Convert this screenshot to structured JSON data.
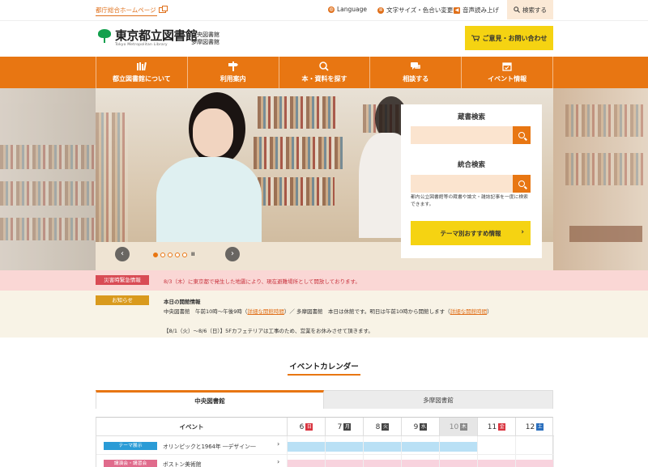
{
  "utility": {
    "portal_link": "都庁総合ホームページ",
    "language": "Language",
    "text_size": "文字サイズ・色合い変更",
    "voice": "音声読み上げ",
    "search": "検索する"
  },
  "header": {
    "logo_title": "東京都立図書館",
    "logo_sub": "Tokyo Metropolitan Library",
    "branch1": "中央図書館",
    "branch2": "多摩図書館",
    "contact": "ご意見・お問い合わせ"
  },
  "nav": {
    "items": [
      {
        "label": "都立図書館について",
        "icon": "books-icon"
      },
      {
        "label": "利用案内",
        "icon": "signpost-icon"
      },
      {
        "label": "本・資料を探す",
        "icon": "book-search-icon"
      },
      {
        "label": "相談する",
        "icon": "chat-icon"
      },
      {
        "label": "イベント情報",
        "icon": "calendar-icon"
      }
    ]
  },
  "hero": {
    "prev": "‹",
    "next": "›",
    "slide_count": 5,
    "active_slide": 1,
    "pause": "II"
  },
  "search_panel": {
    "catalog_heading": "蔵書検索",
    "unified_heading": "統合検索",
    "note": "都内公立図書館等の蔵書や論文・雑誌記事を一度に検索できます。",
    "theme_button": "テーマ別おすすめ情報"
  },
  "emergency": {
    "label": "災害時緊急情報",
    "text": "8/3（木）に東京都で発生した地震により、現在避難場所として開放しております。"
  },
  "news": {
    "label": "お知らせ",
    "heading": "本日の開館情報",
    "line1_a": "中央図書館　午前10時〜午後9時（",
    "line1_link1": "詳細な開館時間",
    "line1_b": "）／ 多摩図書館　本日は休館です。明日は午前10時から開館します（",
    "line1_link2": "詳細な開館時間",
    "line1_c": "）",
    "line2": "【8/1（火）〜8/6（日）】5Fカフェテリアは工事のため、営業をお休みさせて頂きます。"
  },
  "calendar": {
    "title": "イベントカレンダー",
    "tab_active": "中央図書館",
    "tab_inactive": "多摩図書館",
    "event_header": "イベント",
    "days": [
      {
        "num": "6",
        "wd": "日",
        "color": "#d9343f"
      },
      {
        "num": "7",
        "wd": "月",
        "color": "#444444"
      },
      {
        "num": "8",
        "wd": "火",
        "color": "#444444"
      },
      {
        "num": "9",
        "wd": "水",
        "color": "#444444"
      },
      {
        "num": "10",
        "wd": "木",
        "color": "#888888"
      },
      {
        "num": "11",
        "wd": "金",
        "color": "#d9343f"
      },
      {
        "num": "12",
        "wd": "土",
        "color": "#2b6fbd"
      }
    ],
    "rows": [
      {
        "category": "テーマ展示",
        "cat_color": "#2a9bd6",
        "title": "オリンピックと1964年 ―デザイン―",
        "bar_color": "#b9e0f5",
        "bar_start_day": 0,
        "bar_days": 5
      },
      {
        "category": "講演会・講習会",
        "cat_color": "#e06b8c",
        "title": "ボストン美術館",
        "bar_color": "#f8d3de",
        "bar_start_day": 0,
        "bar_days": 7
      }
    ]
  },
  "colors": {
    "accent": "#e87612",
    "yellow": "#f5d312",
    "emergency": "#d94b55",
    "notice": "#d99a1d"
  }
}
